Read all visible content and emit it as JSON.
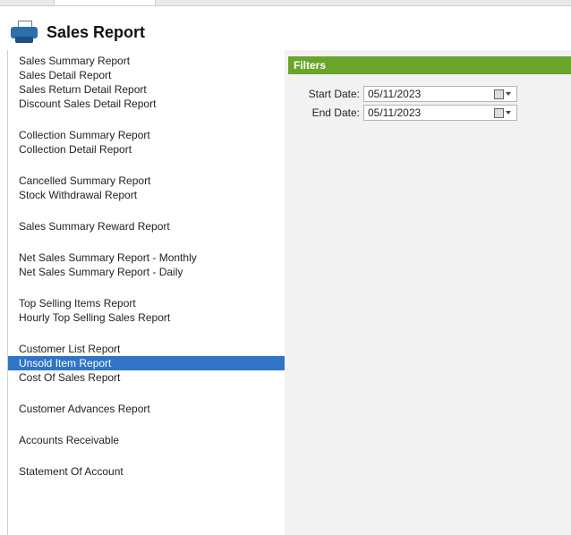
{
  "header": {
    "title": "Sales Report",
    "icon": "printer-icon"
  },
  "reports": [
    {
      "label": "Sales Summary Report",
      "gap": false,
      "selected": false
    },
    {
      "label": "Sales Detail Report",
      "gap": false,
      "selected": false
    },
    {
      "label": "Sales Return Detail Report",
      "gap": false,
      "selected": false
    },
    {
      "label": "Discount Sales Detail Report",
      "gap": false,
      "selected": false
    },
    {
      "label": "Collection Summary Report",
      "gap": true,
      "selected": false
    },
    {
      "label": "Collection Detail Report",
      "gap": false,
      "selected": false
    },
    {
      "label": "Cancelled Summary Report",
      "gap": true,
      "selected": false
    },
    {
      "label": "Stock Withdrawal Report",
      "gap": false,
      "selected": false
    },
    {
      "label": "Sales Summary Reward Report",
      "gap": true,
      "selected": false
    },
    {
      "label": "Net Sales Summary Report - Monthly",
      "gap": true,
      "selected": false
    },
    {
      "label": "Net Sales Summary Report - Daily",
      "gap": false,
      "selected": false
    },
    {
      "label": "Top Selling Items Report",
      "gap": true,
      "selected": false
    },
    {
      "label": "Hourly Top Selling Sales Report",
      "gap": false,
      "selected": false
    },
    {
      "label": "Customer List Report",
      "gap": true,
      "selected": false
    },
    {
      "label": "Unsold Item Report",
      "gap": false,
      "selected": true
    },
    {
      "label": "Cost Of Sales Report",
      "gap": false,
      "selected": false
    },
    {
      "label": "Customer Advances Report",
      "gap": true,
      "selected": false
    },
    {
      "label": "Accounts Receivable",
      "gap": true,
      "selected": false
    },
    {
      "label": "Statement Of Account",
      "gap": true,
      "selected": false
    }
  ],
  "filters": {
    "title": "Filters",
    "start_label": "Start Date:",
    "start_value": "05/11/2023",
    "end_label": "End Date:",
    "end_value": "05/11/2023"
  },
  "colors": {
    "accent": "#6aa52b",
    "selected": "#2f74c6"
  }
}
